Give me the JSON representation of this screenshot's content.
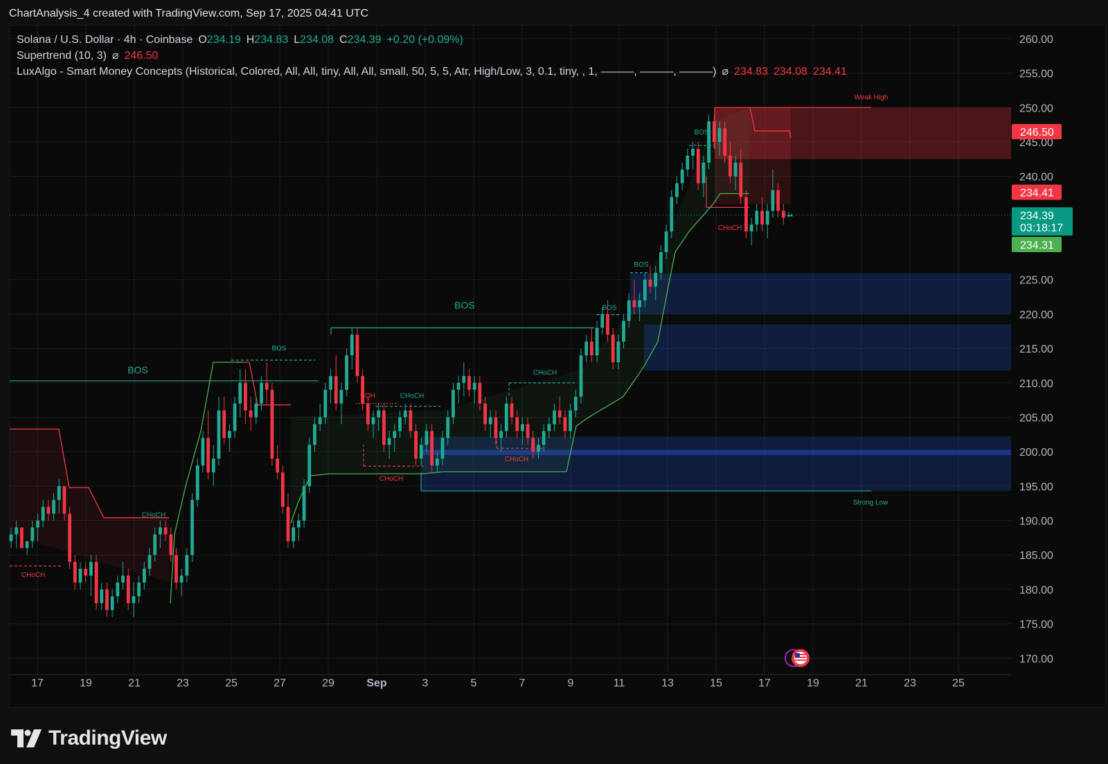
{
  "header": {
    "title": "ChartAnalysis_4 created with TradingView.com, Sep 17, 2025 04:41 UTC"
  },
  "legend": {
    "symbol": "Solana / U.S. Dollar · 4h · Coinbase",
    "o_label": "O",
    "o_value": "234.19",
    "h_label": "H",
    "h_value": "234.83",
    "l_label": "L",
    "l_value": "234.08",
    "c_label": "C",
    "c_value": "234.39",
    "change": "+0.20 (+0.09%)",
    "supertrend_label": "Supertrend (10, 3)",
    "supertrend_value": "246.50",
    "luxalgo_label": "LuxAlgo - Smart Money Concepts (Historical, Colored, All, All, tiny, All, All, small, 50, 5, 5, Atr, High/Low, 3, 0.1, tiny, , 1, ———, ———, ———)",
    "luxalgo_v1": "234.83",
    "luxalgo_v2": "234.08",
    "luxalgo_v3": "234.41",
    "eye_icon": "visibility-off-icon"
  },
  "brand": {
    "name": "TradingView",
    "icon": "tradingview-logo-icon"
  },
  "colors": {
    "up": "#22ab94",
    "down": "#f23645",
    "bg": "#0a0a0a",
    "supertrend_up": "#4caf50",
    "supertrend_down": "#f23645",
    "demand_zone": "#1e3a6e",
    "supply_zone": "#5c2a2e"
  },
  "chart_data": {
    "type": "candlestick",
    "ylim": [
      165,
      262
    ],
    "y_ticks": [
      "260.00",
      "255.00",
      "250.00",
      "245.00",
      "240.00",
      "225.00",
      "220.00",
      "215.00",
      "210.00",
      "205.00",
      "200.00",
      "195.00",
      "190.00",
      "185.00",
      "180.00",
      "175.00",
      "170.00"
    ],
    "x_ticks": [
      "17",
      "19",
      "21",
      "23",
      "25",
      "27",
      "29",
      "Sep",
      "3",
      "5",
      "7",
      "9",
      "11",
      "13",
      "15",
      "17",
      "19",
      "21",
      "23",
      "25"
    ],
    "price_labels": [
      {
        "text": "246.50",
        "value": 246.5,
        "color": "#f23645"
      },
      {
        "text": "234.41",
        "value": 237.7,
        "color": "#f23645"
      },
      {
        "text": "234.39",
        "value": 234.39,
        "color": "#089981"
      },
      {
        "text": "03:18:17",
        "value": 232.6,
        "color": "#089981"
      },
      {
        "text": "234.31",
        "value": 230.1,
        "color": "#4caf50"
      }
    ],
    "annotations": [
      {
        "text": "BOS",
        "value": 211.8,
        "color": "#22ab94",
        "size": "large"
      },
      {
        "text": "BOS",
        "value": 221.2,
        "color": "#22ab94",
        "size": "large"
      },
      {
        "text": "BOS",
        "value": 215.1,
        "color": "#22ab94",
        "size": "small"
      },
      {
        "text": "BOS",
        "value": 221.0,
        "color": "#22ab94",
        "size": "small"
      },
      {
        "text": "BOS",
        "value": 227.3,
        "color": "#22ab94",
        "size": "small"
      },
      {
        "text": "BOS",
        "value": 246.5,
        "color": "#22ab94",
        "size": "small"
      },
      {
        "text": "CHoCH",
        "value": 182.2,
        "color": "#f23645",
        "size": "small"
      },
      {
        "text": "CHoCH",
        "value": 190.9,
        "color": "#22ab94",
        "size": "small"
      },
      {
        "text": "EQH",
        "value": 208.2,
        "color": "#f23645",
        "size": "small"
      },
      {
        "text": "CHoCH",
        "value": 208.2,
        "color": "#22ab94",
        "size": "small"
      },
      {
        "text": "CHoCH",
        "value": 196.2,
        "color": "#f23645",
        "size": "small"
      },
      {
        "text": "CHoCH",
        "value": 211.6,
        "color": "#22ab94",
        "size": "small"
      },
      {
        "text": "CHoCH",
        "value": 199.0,
        "color": "#f23645",
        "size": "small"
      },
      {
        "text": "CHoCH",
        "value": 232.6,
        "color": "#f23645",
        "size": "small"
      },
      {
        "text": "Weak High",
        "value": 251.6,
        "color": "#f23645",
        "size": "small"
      },
      {
        "text": "Strong Low",
        "value": 192.7,
        "color": "#22ab94",
        "size": "small"
      }
    ],
    "candles": [
      [
        187,
        189,
        186,
        188
      ],
      [
        188,
        190,
        186,
        189
      ],
      [
        189,
        188,
        186,
        186
      ],
      [
        186,
        187,
        185,
        187
      ],
      [
        187,
        190,
        186,
        189
      ],
      [
        189,
        191,
        187,
        190
      ],
      [
        190,
        193,
        189,
        192
      ],
      [
        192,
        193,
        190,
        191
      ],
      [
        191,
        194,
        190,
        193
      ],
      [
        193,
        196,
        191,
        195
      ],
      [
        195,
        195,
        190,
        191
      ],
      [
        191,
        192,
        183,
        184
      ],
      [
        184,
        185,
        180,
        181
      ],
      [
        181,
        184,
        180,
        183
      ],
      [
        183,
        184,
        181,
        182
      ],
      [
        182,
        185,
        179,
        184
      ],
      [
        184,
        185,
        177,
        178
      ],
      [
        178,
        181,
        177,
        180
      ],
      [
        180,
        181,
        176,
        177
      ],
      [
        177,
        180,
        176,
        179
      ],
      [
        179,
        182,
        178,
        181
      ],
      [
        181,
        184,
        180,
        182
      ],
      [
        182,
        183,
        177,
        178
      ],
      [
        178,
        181,
        176,
        179
      ],
      [
        179,
        182,
        178,
        181
      ],
      [
        181,
        184,
        180,
        183
      ],
      [
        183,
        186,
        182,
        185
      ],
      [
        185,
        189,
        184,
        188
      ],
      [
        188,
        190,
        186,
        189
      ],
      [
        189,
        190,
        187,
        188
      ],
      [
        188,
        189,
        184,
        185
      ],
      [
        185,
        186,
        180,
        181
      ],
      [
        181,
        183,
        179,
        182
      ],
      [
        182,
        186,
        181,
        185
      ],
      [
        185,
        194,
        184,
        193
      ],
      [
        193,
        199,
        192,
        198
      ],
      [
        198,
        203,
        197,
        202
      ],
      [
        202,
        206,
        196,
        197
      ],
      [
        197,
        201,
        195,
        199
      ],
      [
        199,
        208,
        198,
        206
      ],
      [
        206,
        208,
        201,
        202
      ],
      [
        202,
        204,
        200,
        203
      ],
      [
        203,
        208,
        202,
        207
      ],
      [
        207,
        212,
        205,
        210
      ],
      [
        210,
        212,
        204,
        206
      ],
      [
        206,
        208,
        203,
        205
      ],
      [
        205,
        208,
        204,
        207
      ],
      [
        207,
        211,
        206,
        210
      ],
      [
        210,
        213,
        207,
        209
      ],
      [
        209,
        210,
        198,
        199
      ],
      [
        199,
        201,
        196,
        197
      ],
      [
        197,
        198,
        191,
        192
      ],
      [
        192,
        194,
        186,
        187
      ],
      [
        187,
        190,
        186,
        189
      ],
      [
        189,
        191,
        187,
        190
      ],
      [
        190,
        196,
        189,
        195
      ],
      [
        195,
        202,
        194,
        201
      ],
      [
        201,
        205,
        200,
        204
      ],
      [
        204,
        207,
        203,
        205
      ],
      [
        205,
        210,
        204,
        209
      ],
      [
        209,
        212,
        207,
        211
      ],
      [
        211,
        214,
        206,
        207
      ],
      [
        207,
        210,
        204,
        209
      ],
      [
        209,
        215,
        208,
        214
      ],
      [
        214,
        218,
        212,
        217
      ],
      [
        217,
        218,
        210,
        211
      ],
      [
        211,
        212,
        206,
        207
      ],
      [
        207,
        208,
        203,
        204
      ],
      [
        204,
        206,
        202,
        205
      ],
      [
        205,
        207,
        203,
        206
      ],
      [
        206,
        207,
        200,
        201
      ],
      [
        201,
        203,
        199,
        202
      ],
      [
        202,
        204,
        200,
        203
      ],
      [
        203,
        206,
        202,
        205
      ],
      [
        205,
        207,
        204,
        206
      ],
      [
        206,
        207,
        202,
        203
      ],
      [
        203,
        204,
        198,
        199
      ],
      [
        199,
        202,
        198,
        201
      ],
      [
        201,
        204,
        200,
        203
      ],
      [
        203,
        204,
        197,
        198
      ],
      [
        198,
        200,
        197,
        199
      ],
      [
        199,
        203,
        198,
        202
      ],
      [
        202,
        206,
        201,
        205
      ],
      [
        205,
        210,
        204,
        209
      ],
      [
        209,
        211,
        207,
        210
      ],
      [
        210,
        213,
        208,
        211
      ],
      [
        211,
        212,
        208,
        209
      ],
      [
        209,
        211,
        207,
        210
      ],
      [
        210,
        211,
        206,
        207
      ],
      [
        207,
        208,
        203,
        204
      ],
      [
        204,
        206,
        202,
        205
      ],
      [
        205,
        206,
        201,
        202
      ],
      [
        202,
        204,
        200,
        203
      ],
      [
        203,
        208,
        202,
        207
      ],
      [
        207,
        208,
        204,
        205
      ],
      [
        205,
        206,
        202,
        203
      ],
      [
        203,
        205,
        201,
        204
      ],
      [
        204,
        205,
        201,
        202
      ],
      [
        202,
        203,
        199,
        200
      ],
      [
        200,
        202,
        199,
        201
      ],
      [
        201,
        204,
        200,
        203
      ],
      [
        203,
        205,
        202,
        204
      ],
      [
        204,
        207,
        203,
        206
      ],
      [
        206,
        208,
        204,
        205
      ],
      [
        205,
        206,
        202,
        203
      ],
      [
        203,
        207,
        202,
        206
      ],
      [
        206,
        209,
        205,
        208
      ],
      [
        208,
        215,
        207,
        214
      ],
      [
        214,
        217,
        213,
        216
      ],
      [
        216,
        218,
        213,
        214
      ],
      [
        214,
        219,
        213,
        218
      ],
      [
        218,
        221,
        217,
        220
      ],
      [
        220,
        222,
        216,
        217
      ],
      [
        217,
        218,
        212,
        213
      ],
      [
        213,
        217,
        212,
        216
      ],
      [
        216,
        220,
        215,
        219
      ],
      [
        219,
        223,
        218,
        222
      ],
      [
        222,
        225,
        220,
        221
      ],
      [
        221,
        223,
        219,
        222
      ],
      [
        222,
        226,
        221,
        225
      ],
      [
        225,
        227,
        223,
        224
      ],
      [
        224,
        227,
        222,
        226
      ],
      [
        226,
        230,
        225,
        229
      ],
      [
        229,
        233,
        228,
        232
      ],
      [
        232,
        238,
        231,
        237
      ],
      [
        237,
        240,
        236,
        239
      ],
      [
        239,
        242,
        238,
        241
      ],
      [
        241,
        244,
        240,
        243
      ],
      [
        243,
        245,
        241,
        244
      ],
      [
        244,
        245,
        238,
        239
      ],
      [
        239,
        243,
        237,
        242
      ],
      [
        242,
        249,
        241,
        248
      ],
      [
        248,
        249,
        244,
        245
      ],
      [
        245,
        248,
        243,
        247
      ],
      [
        247,
        248,
        242,
        243
      ],
      [
        243,
        245,
        239,
        240
      ],
      [
        240,
        243,
        238,
        242
      ],
      [
        242,
        244,
        236,
        237
      ],
      [
        237,
        238,
        231,
        232
      ],
      [
        232,
        234,
        230,
        233
      ],
      [
        233,
        236,
        232,
        235
      ],
      [
        235,
        237,
        232,
        233
      ],
      [
        233,
        236,
        231,
        235
      ],
      [
        235,
        241,
        234,
        238
      ],
      [
        238,
        239,
        234,
        235
      ],
      [
        235,
        236,
        233,
        234
      ],
      [
        234.19,
        234.83,
        234.08,
        234.39
      ]
    ]
  }
}
